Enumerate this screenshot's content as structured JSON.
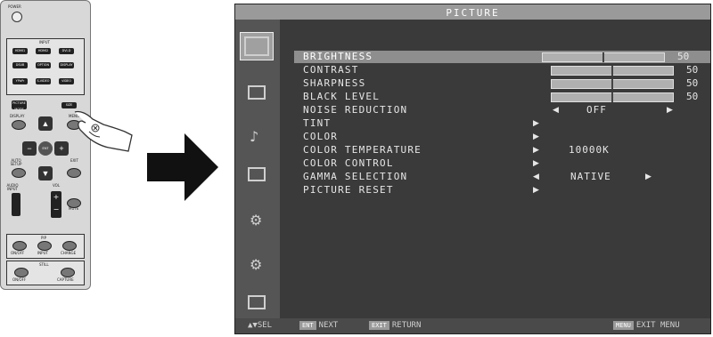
{
  "remote": {
    "power_label": "POWER",
    "input_label": "INPUT",
    "input_buttons": [
      "HDMI1",
      "HDMI2",
      "DVI-D",
      "DSUB",
      "OPTION",
      "DISPLAY PORT",
      "YPbPr",
      "S-VIDEO",
      "VIDEO"
    ],
    "picture_mode_label": "PICTURE MODE",
    "size_label": "SIZE",
    "display_label": "DISPLAY",
    "menu_label": "MENU",
    "ent_label": "ENT",
    "auto_setup_label": "AUTO SETUP",
    "exit_label": "EXIT",
    "audio_input_label": "AUDIO INPUT",
    "vol_label": "VOL",
    "mute_label": "MUTE",
    "pip_label": "PIP",
    "pip_buttons": [
      "ON/OFF",
      "INPUT",
      "CHANGE"
    ],
    "still_label": "STILL",
    "still_buttons": [
      "ON/OFF",
      "CAPTURE"
    ]
  },
  "osd": {
    "title": "PICTURE",
    "items": [
      {
        "label": "BRIGHTNESS",
        "value": "50",
        "level": 0.5,
        "selected": true
      },
      {
        "label": "CONTRAST",
        "value": "50",
        "level": 0.5
      },
      {
        "label": "SHARPNESS",
        "value": "50",
        "level": 0.5
      },
      {
        "label": "BLACK LEVEL",
        "value": "50",
        "level": 0.5
      },
      {
        "label": "NOISE REDUCTION",
        "option": "OFF"
      },
      {
        "label": "TINT"
      },
      {
        "label": "COLOR"
      },
      {
        "label": "COLOR TEMPERATURE",
        "option": "10000K"
      },
      {
        "label": "COLOR CONTROL"
      },
      {
        "label": "GAMMA SELECTION",
        "option": "NATIVE"
      },
      {
        "label": "PICTURE RESET"
      }
    ],
    "sidebar_icons": [
      "picture-icon",
      "screen-icon",
      "audio-icon",
      "schedule-icon",
      "pip-icon",
      "option-icon",
      "multi-icon",
      "display-protection-icon"
    ],
    "footer": {
      "sel": "SEL",
      "sel_icon": "▲▼",
      "next_key": "ENT",
      "next": "NEXT",
      "return_key": "EXIT",
      "return": "RETURN",
      "exit_key": "MENU",
      "exit": "EXIT MENU"
    }
  }
}
